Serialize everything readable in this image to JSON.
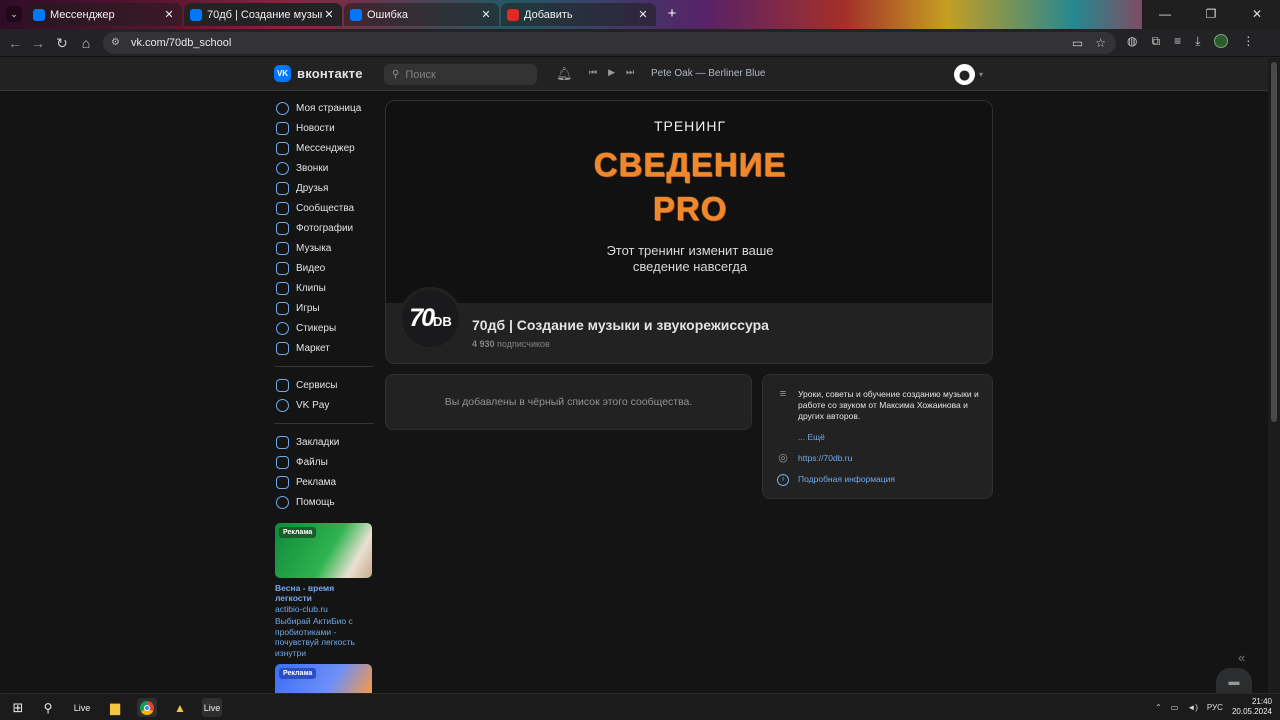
{
  "browser": {
    "tabs": [
      {
        "title": "Мессенджер",
        "favicon_color": "#0077ff",
        "active": false
      },
      {
        "title": "70дб | Создание музыки и зву",
        "favicon_color": "#0077ff",
        "active": true
      },
      {
        "title": "Ошибка",
        "favicon_color": "#0077ff",
        "active": false
      },
      {
        "title": "Добавить",
        "favicon_color": "#e02a2a",
        "active": false
      }
    ],
    "url": "vk.com/70db_school"
  },
  "header": {
    "logo_text": "вконтакте",
    "search_placeholder": "Поиск",
    "now_playing": "Pete Oak — Berliner Blue"
  },
  "sidebar": {
    "items": [
      {
        "label": "Моя страница",
        "icon": "user-circle-icon"
      },
      {
        "label": "Новости",
        "icon": "newsfeed-icon"
      },
      {
        "label": "Мессенджер",
        "icon": "message-icon"
      },
      {
        "label": "Звонки",
        "icon": "phone-icon"
      },
      {
        "label": "Друзья",
        "icon": "users-icon"
      },
      {
        "label": "Сообщества",
        "icon": "communities-icon"
      },
      {
        "label": "Фотографии",
        "icon": "photo-icon"
      },
      {
        "label": "Музыка",
        "icon": "music-icon"
      },
      {
        "label": "Видео",
        "icon": "video-icon"
      },
      {
        "label": "Клипы",
        "icon": "clips-icon"
      },
      {
        "label": "Игры",
        "icon": "gamepad-icon"
      },
      {
        "label": "Стикеры",
        "icon": "smile-icon"
      },
      {
        "label": "Маркет",
        "icon": "market-bag-icon"
      }
    ],
    "items2": [
      {
        "label": "Сервисы",
        "icon": "services-icon"
      },
      {
        "label": "VK Pay",
        "icon": "vkpay-icon"
      }
    ],
    "items3": [
      {
        "label": "Закладки",
        "icon": "bookmark-icon"
      },
      {
        "label": "Файлы",
        "icon": "file-icon"
      },
      {
        "label": "Реклама",
        "icon": "ads-icon"
      },
      {
        "label": "Помощь",
        "icon": "help-icon"
      }
    ]
  },
  "ads": [
    {
      "tag": "Реклама",
      "title": "Весна - время легкости",
      "domain": "actibio-club.ru",
      "description": "Выбирай АктиБио с пробиотиками - почувствуй легкость изнутри"
    },
    {
      "tag": "Реклама"
    }
  ],
  "group": {
    "cover": {
      "kicker": "ТРЕНИНГ",
      "headline_1": "СВЕДЕНИЕ",
      "headline_2": "PRO",
      "tagline_1": "Этот тренинг изменит ваше",
      "tagline_2": "сведение навсегда"
    },
    "avatar_text": "70",
    "avatar_suffix": "DB",
    "name": "70дб | Создание музыки и звукорежиссура",
    "subscribers_count": "4 930",
    "subscribers_label": "подписчиков",
    "blacklist_notice": "Вы добавлены в чёрный список этого сообщества.",
    "description": "Уроки, советы и обучение созданию музыки и работе со звуком от Максима Хожаинова и других авторов.",
    "more_label": "... Ещё",
    "website": "https://70db.ru",
    "details_label": "Подробная информация"
  },
  "taskbar": {
    "live_label": "Live",
    "lang": "РУС",
    "time": "21:40",
    "date": "20.05.2024"
  },
  "colors": {
    "accent": "#71aaeb",
    "vk_blue": "#0077ff",
    "cover_orange": "#f0872a"
  }
}
